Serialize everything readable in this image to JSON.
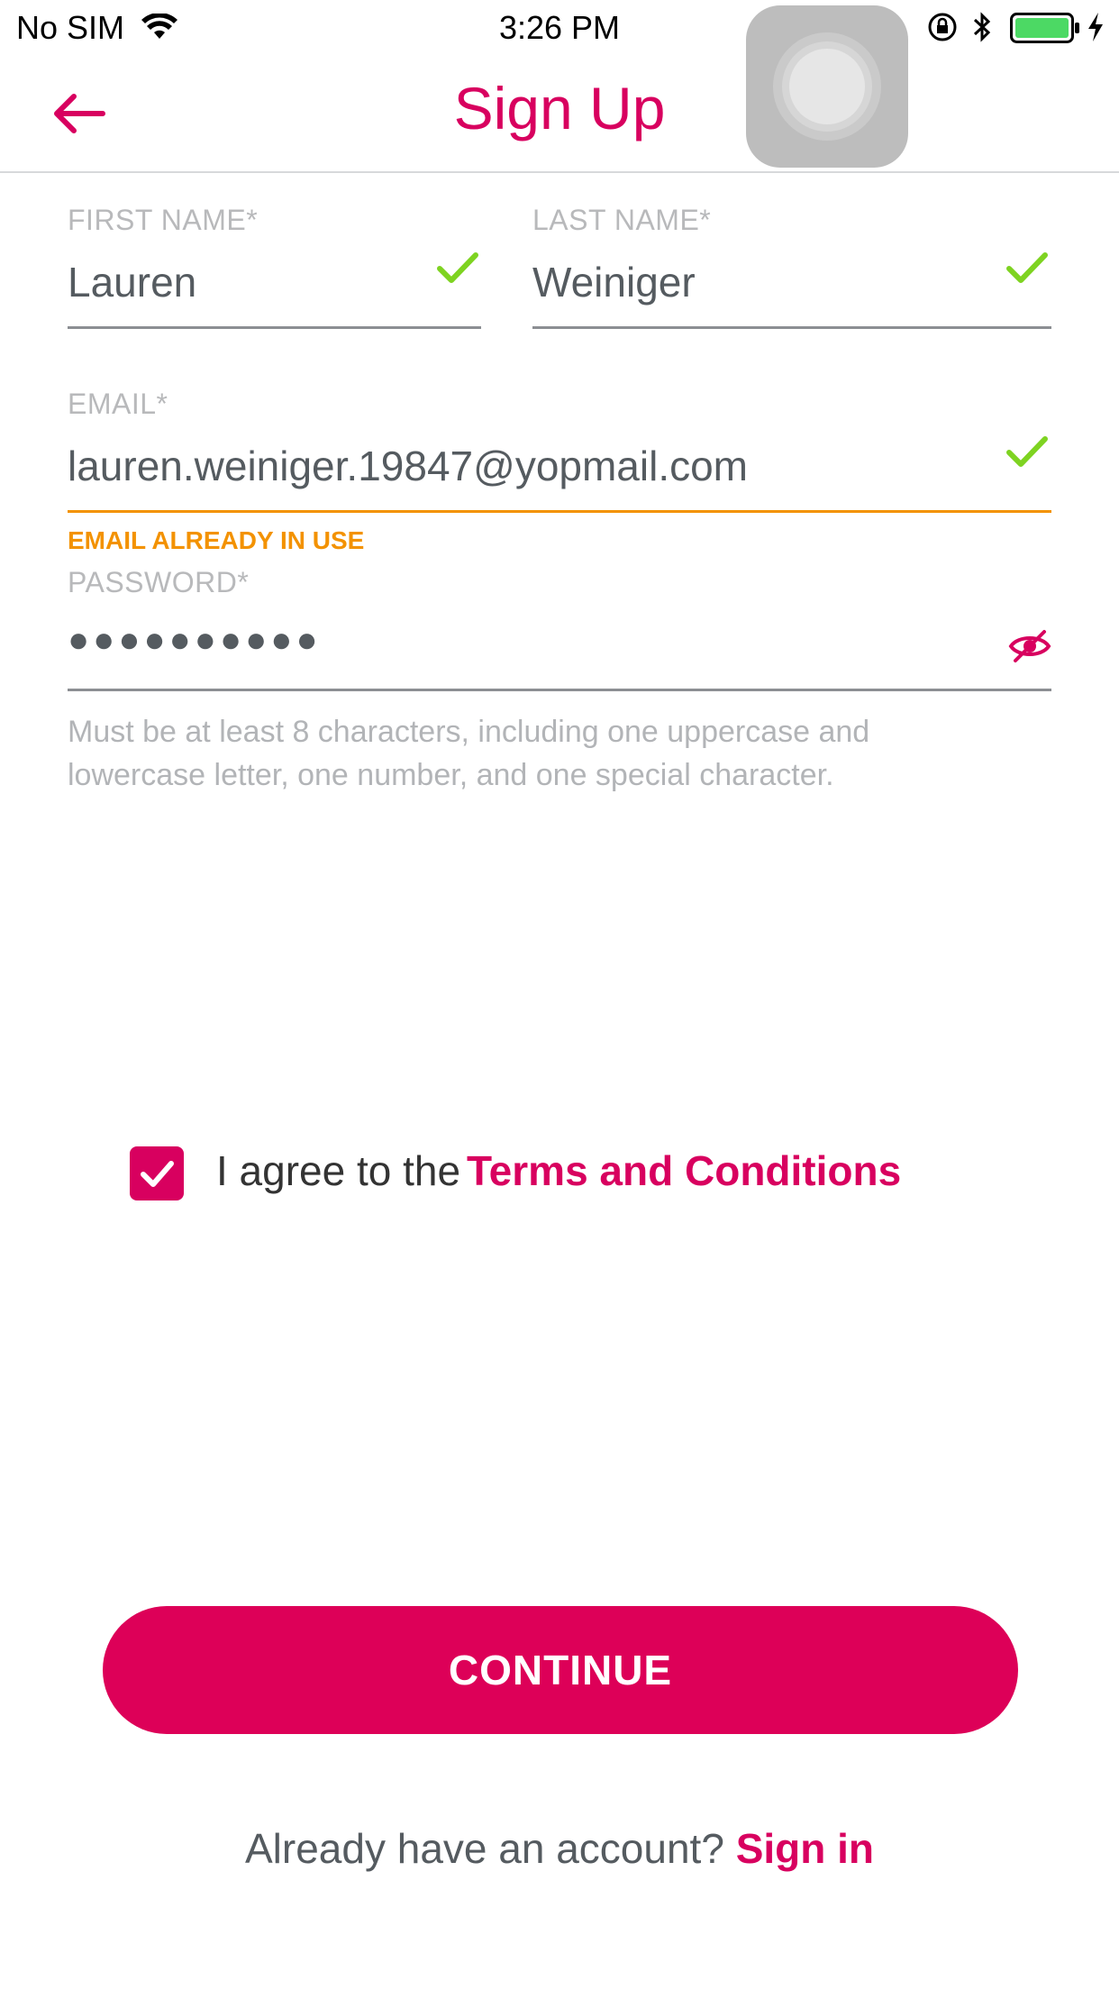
{
  "status_bar": {
    "carrier": "No SIM",
    "time": "3:26 PM"
  },
  "header": {
    "title": "Sign Up"
  },
  "form": {
    "first_name": {
      "label": "FIRST NAME*",
      "value": "Lauren"
    },
    "last_name": {
      "label": "LAST NAME*",
      "value": "Weiniger"
    },
    "email": {
      "label": "EMAIL*",
      "value": "lauren.weiniger.19847@yopmail.com",
      "error": "EMAIL ALREADY IN USE"
    },
    "password": {
      "label": "PASSWORD*",
      "value": "●●●●●●●●●●",
      "hint": "Must be at least 8 characters, including one uppercase and lowercase letter, one number, and one special character."
    }
  },
  "agreement": {
    "checked": true,
    "prefix": "I agree to the",
    "link": "Terms and Conditions"
  },
  "continue_label": "CONTINUE",
  "footer": {
    "prompt": "Already have an account?",
    "link": "Sign in"
  },
  "colors": {
    "accent": "#d8005f",
    "valid": "#7ed321",
    "warning": "#f39200"
  }
}
